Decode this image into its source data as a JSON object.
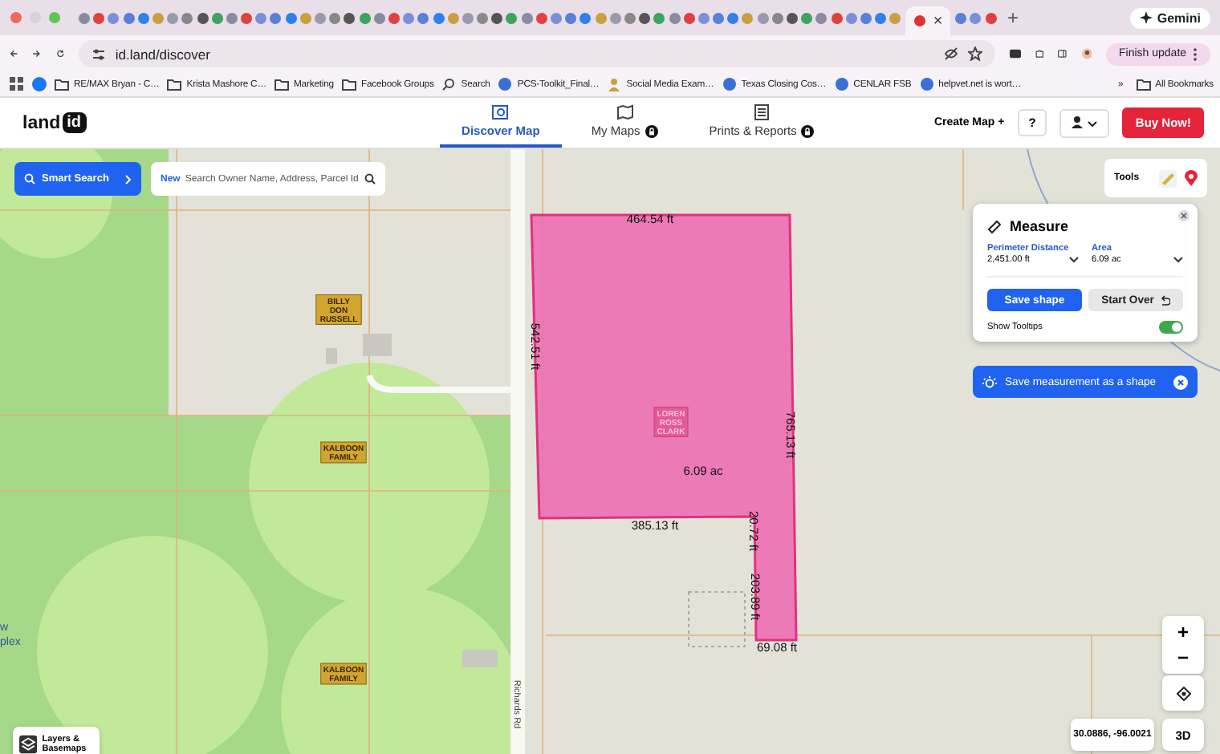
{
  "browser": {
    "close_tab": "×",
    "new_tab": "+",
    "gemini": "Gemini",
    "url": "id.land/discover",
    "update_button": "Finish update",
    "bookmarks": [
      {
        "kind": "facebook"
      },
      {
        "kind": "folder",
        "label": "RE/MAX Bryan - C…"
      },
      {
        "kind": "folder",
        "label": "Krista Mashore C…"
      },
      {
        "kind": "folder",
        "label": "Marketing"
      },
      {
        "kind": "folder",
        "label": "Facebook Groups"
      },
      {
        "kind": "search",
        "label": "Search"
      },
      {
        "kind": "globe",
        "label": "PCS-Toolkit_Final…"
      },
      {
        "kind": "person",
        "label": "Social Media Exam…"
      },
      {
        "kind": "globe",
        "label": "Texas Closing Cos…"
      },
      {
        "kind": "globe",
        "label": "CENLAR FSB"
      },
      {
        "kind": "globe",
        "label": "helpvet.net is wort…"
      }
    ],
    "more": "»",
    "all_bookmarks": "All Bookmarks"
  },
  "header": {
    "logo_word": "land",
    "logo_badge": "id",
    "nav": [
      {
        "label": "Discover Map",
        "selected": true,
        "locked": false
      },
      {
        "label": "My Maps",
        "selected": false,
        "locked": true
      },
      {
        "label": "Prints & Reports",
        "selected": false,
        "locked": true
      }
    ],
    "create_map": "Create Map +",
    "help": "?",
    "buy": "Buy Now!"
  },
  "search": {
    "button": "Smart Search",
    "tag": "New",
    "placeholder": "Search Owner Name, Address, Parcel Id"
  },
  "tools": {
    "label": "Tools"
  },
  "measure": {
    "title": "Measure",
    "fields": [
      {
        "label": "Perimeter Distance",
        "value": "2,451.00 ft"
      },
      {
        "label": "Area",
        "value": "6.09 ac"
      }
    ],
    "save": "Save shape",
    "start_over": "Start Over",
    "tooltips": {
      "label": "Show Tooltips",
      "on": true
    }
  },
  "banner": {
    "text": "Save measurement as a shape"
  },
  "map": {
    "owners": [
      {
        "lines": [
          "BILLY",
          "DON",
          "RUSSELL"
        ],
        "kind": "neighbor"
      },
      {
        "lines": [
          "KALBOON",
          "FAMILY"
        ],
        "kind": "neighbor"
      },
      {
        "lines": [
          "KALBOON",
          "FAMILY"
        ],
        "kind": "neighbor"
      },
      {
        "lines": [
          "LOREN",
          "ROSS",
          "CLARK"
        ],
        "kind": "selected"
      }
    ],
    "measurements": [
      "464.54 ft",
      "542.51 ft",
      "765.13 ft",
      "6.09 ac",
      "385.13 ft",
      "20.72 ft",
      "203.89 ft",
      "69.08 ft"
    ],
    "road": "Richards Rd",
    "edge_text": [
      "w",
      "plex"
    ]
  },
  "controls": {
    "zoom_in": "+",
    "zoom_out": "−",
    "coordinates": "30.0886, -96.0021",
    "view_3d": "3D",
    "layers": "Layers & Basemaps"
  }
}
